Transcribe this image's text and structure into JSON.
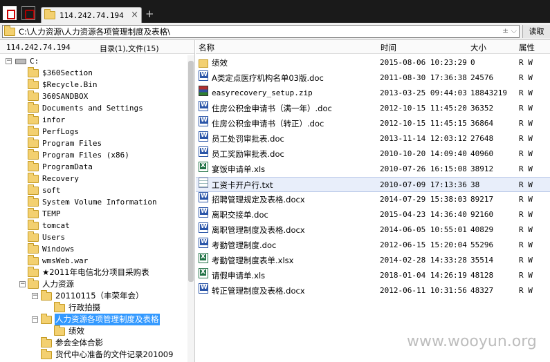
{
  "tab": {
    "title": "114.242.74.194",
    "close": "×",
    "new": "+"
  },
  "address": {
    "path": "C:\\人力资源\\人力资源各项管理制度及表格\\",
    "controls": "±  ⌵",
    "read_label": "读取"
  },
  "left": {
    "ip": "114.242.74.194",
    "counts": "目录(1),文件(15)"
  },
  "columns": {
    "name": "名称",
    "time": "时间",
    "size": "大小",
    "attr": "属性"
  },
  "tree": [
    {
      "label": "C:",
      "box": "⊟",
      "icon": "drive"
    },
    {
      "label": "$360Section",
      "icon": "folder"
    },
    {
      "label": "$Recycle.Bin",
      "icon": "folder"
    },
    {
      "label": "360SANDBOX",
      "icon": "folder"
    },
    {
      "label": "Documents and Settings",
      "icon": "folder"
    },
    {
      "label": "infor",
      "icon": "folder"
    },
    {
      "label": "PerfLogs",
      "icon": "folder"
    },
    {
      "label": "Program Files",
      "icon": "folder"
    },
    {
      "label": "Program Files (x86)",
      "icon": "folder"
    },
    {
      "label": "ProgramData",
      "icon": "folder"
    },
    {
      "label": "Recovery",
      "icon": "folder"
    },
    {
      "label": "soft",
      "icon": "folder"
    },
    {
      "label": "System Volume Information",
      "icon": "folder"
    },
    {
      "label": "TEMP",
      "icon": "folder"
    },
    {
      "label": "tomcat",
      "icon": "folder"
    },
    {
      "label": "Users",
      "icon": "folder"
    },
    {
      "label": "Windows",
      "icon": "folder"
    },
    {
      "label": "wmsWeb.war",
      "icon": "folder"
    },
    {
      "label": "★2011年电信北分项目采购表",
      "icon": "folder"
    },
    {
      "label": "人力资源",
      "box": "⊟",
      "icon": "folder"
    },
    {
      "label": "20110115（丰荣年会）",
      "box": "⊟",
      "icon": "folder"
    },
    {
      "label": "行政拍摄",
      "icon": "folder"
    },
    {
      "label": "人力资源各项管理制度及表格",
      "box": "⊟",
      "icon": "folder",
      "selected": true
    },
    {
      "label": "绩效",
      "icon": "folder"
    },
    {
      "label": "参会全体合影",
      "icon": "folder"
    },
    {
      "label": "货代中心准备的文件记录201009",
      "icon": "folder"
    }
  ],
  "files": [
    {
      "name": "绩效",
      "time": "2015-08-06 10:23:29",
      "size": "0",
      "attr": "R W",
      "type": "fld"
    },
    {
      "name": "A类定点医疗机构名单03版.doc",
      "time": "2011-08-30 17:36:38",
      "size": "24576",
      "attr": "R W",
      "type": "doc"
    },
    {
      "name": "easyrecovery_setup.zip",
      "time": "2013-03-25 09:44:03",
      "size": "18843219",
      "attr": "R W",
      "type": "zip"
    },
    {
      "name": "住房公积金申请书（满一年）.doc",
      "time": "2012-10-15 11:45:20",
      "size": "36352",
      "attr": "R W",
      "type": "doc"
    },
    {
      "name": "住房公积金申请书（转正）.doc",
      "time": "2012-10-15 11:45:15",
      "size": "36864",
      "attr": "R W",
      "type": "doc"
    },
    {
      "name": "员工处罚审批表.doc",
      "time": "2013-11-14 12:03:12",
      "size": "27648",
      "attr": "R W",
      "type": "doc"
    },
    {
      "name": "员工奖励审批表.doc",
      "time": "2010-10-20 14:09:40",
      "size": "40960",
      "attr": "R W",
      "type": "doc"
    },
    {
      "name": "宴饭申请单.xls",
      "time": "2010-07-26 16:15:08",
      "size": "38912",
      "attr": "R W",
      "type": "xls"
    },
    {
      "name": "工资卡开户行.txt",
      "time": "2010-07-09 17:13:36",
      "size": "38",
      "attr": "R W",
      "type": "txt",
      "highlight": true
    },
    {
      "name": "招聘管理规定及表格.docx",
      "time": "2014-07-29 15:38:03",
      "size": "89217",
      "attr": "R W",
      "type": "doc"
    },
    {
      "name": "离职交接单.doc",
      "time": "2015-04-23 14:36:40",
      "size": "92160",
      "attr": "R W",
      "type": "doc"
    },
    {
      "name": "离职管理制度及表格.docx",
      "time": "2014-06-05 10:55:01",
      "size": "40829",
      "attr": "R W",
      "type": "doc"
    },
    {
      "name": "考勤管理制度.doc",
      "time": "2012-06-15 15:20:04",
      "size": "55296",
      "attr": "R W",
      "type": "doc"
    },
    {
      "name": "考勤管理制度表单.xlsx",
      "time": "2014-02-28 14:33:28",
      "size": "35514",
      "attr": "R W",
      "type": "xls"
    },
    {
      "name": "请假申请单.xls",
      "time": "2018-01-04 14:26:19",
      "size": "48128",
      "attr": "R W",
      "type": "xls"
    },
    {
      "name": "转正管理制度及表格.docx",
      "time": "2012-06-11 10:31:56",
      "size": "48327",
      "attr": "R W",
      "type": "doc"
    }
  ],
  "watermark": "www.wooyun.org"
}
